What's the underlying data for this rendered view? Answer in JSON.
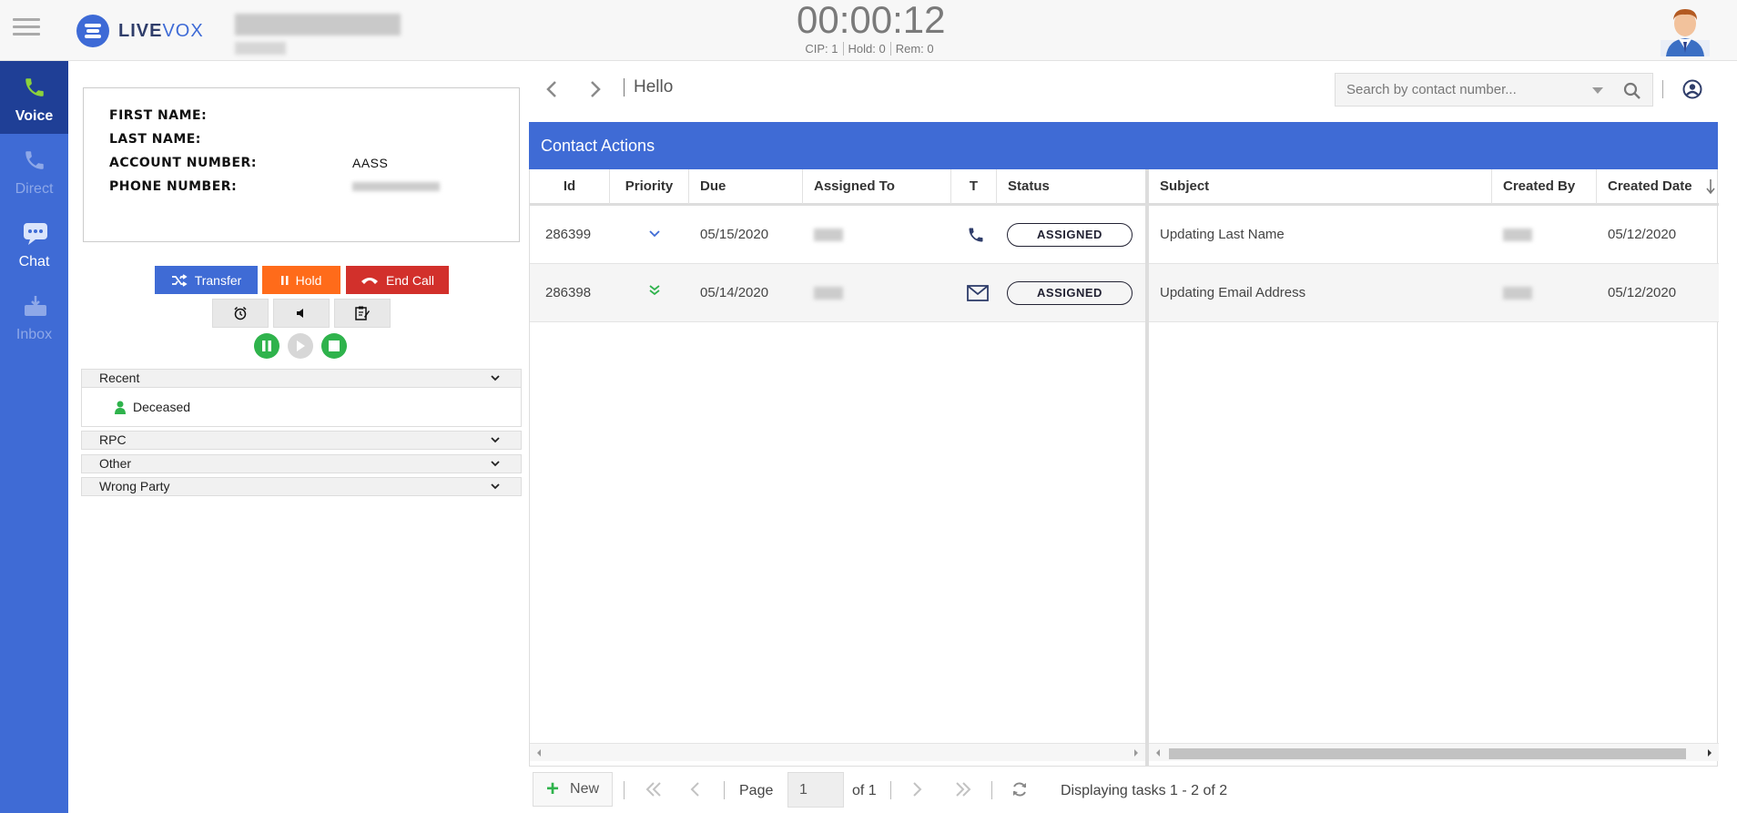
{
  "header": {
    "logo_bold": "LIVE",
    "logo_light": "VOX",
    "timer": "00:00:12",
    "stats": [
      "CIP: 1",
      "Hold: 0",
      "Rem: 0"
    ]
  },
  "leftnav": {
    "items": [
      {
        "label": "Voice",
        "state": "active"
      },
      {
        "label": "Direct",
        "state": "disabled"
      },
      {
        "label": "Chat",
        "state": "enabled"
      },
      {
        "label": "Inbox",
        "state": "disabled"
      }
    ]
  },
  "contact": {
    "first_name_label": "FIRST NAME:",
    "first_name": "",
    "last_name_label": "LAST NAME:",
    "last_name": "",
    "account_label": "ACCOUNT NUMBER:",
    "account": "AASS",
    "phone_label": "PHONE NUMBER:"
  },
  "controls": {
    "transfer": "Transfer",
    "hold": "Hold",
    "end_call": "End Call"
  },
  "dispositions": {
    "groups": [
      "Recent",
      "RPC",
      "Other",
      "Wrong Party"
    ],
    "recent_items": [
      "Deceased"
    ]
  },
  "main": {
    "title": "Hello",
    "search_placeholder": "Search by contact number...",
    "panel_title": "Contact Actions"
  },
  "grid": {
    "columns": [
      "Id",
      "Priority",
      "Due",
      "Assigned To",
      "T",
      "Status",
      "Subject",
      "Created By",
      "Created Date"
    ],
    "sort": {
      "column": "Created Date",
      "direction": "descending"
    },
    "rows": [
      {
        "id": "286399",
        "priority": "low",
        "due": "05/15/2020",
        "type": "phone",
        "status": "ASSIGNED",
        "subject": "Updating Last Name",
        "created": "05/12/2020"
      },
      {
        "id": "286398",
        "priority": "lowest",
        "due": "05/14/2020",
        "type": "email",
        "status": "ASSIGNED",
        "subject": "Updating Email Address",
        "created": "05/12/2020"
      }
    ]
  },
  "pager": {
    "new_label": "New",
    "page_label": "Page",
    "page_value": "1",
    "of_label": "of 1",
    "status": "Displaying tasks 1 - 2 of 2"
  },
  "colors": {
    "brand_blue": "#3f6bd5",
    "nav_active": "#1f3f96",
    "hold_orange": "#ff6b1a",
    "end_red": "#d2302b",
    "green": "#2fb34c"
  }
}
